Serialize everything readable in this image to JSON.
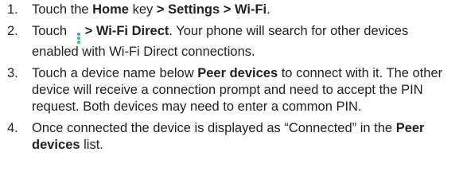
{
  "steps": [
    {
      "number": "1.",
      "parts": [
        {
          "text": "Touch the ",
          "bold": false
        },
        {
          "text": "Home",
          "bold": true
        },
        {
          "text": " key ",
          "bold": false
        },
        {
          "text": "> Settings > Wi-Fi",
          "bold": true
        },
        {
          "text": ".",
          "bold": false
        }
      ]
    },
    {
      "number": "2.",
      "parts": [
        {
          "text": "Touch ",
          "bold": false
        },
        {
          "icon": "more-options-icon"
        },
        {
          "text": "> Wi-Fi Direct",
          "bold": true
        },
        {
          "text": ". Your phone will search for other devices enabled with Wi-Fi Direct connections.",
          "bold": false
        }
      ]
    },
    {
      "number": "3.",
      "parts": [
        {
          "text": "Touch a device name below ",
          "bold": false
        },
        {
          "text": "Peer devices",
          "bold": true
        },
        {
          "text": " to connect with it. The other device will receive a connection prompt and need to accept the PIN request. Both devices may need to enter a common PIN.",
          "bold": false
        }
      ]
    },
    {
      "number": "4.",
      "parts": [
        {
          "text": "Once connected the device is displayed as “Connected” in the ",
          "bold": false
        },
        {
          "text": "Peer devices",
          "bold": true
        },
        {
          "text": " list.",
          "bold": false
        }
      ]
    }
  ],
  "icon_colors": {
    "more-options-icon": [
      "#3aa0e8",
      "#2bb8d8",
      "#3ac86a"
    ]
  }
}
